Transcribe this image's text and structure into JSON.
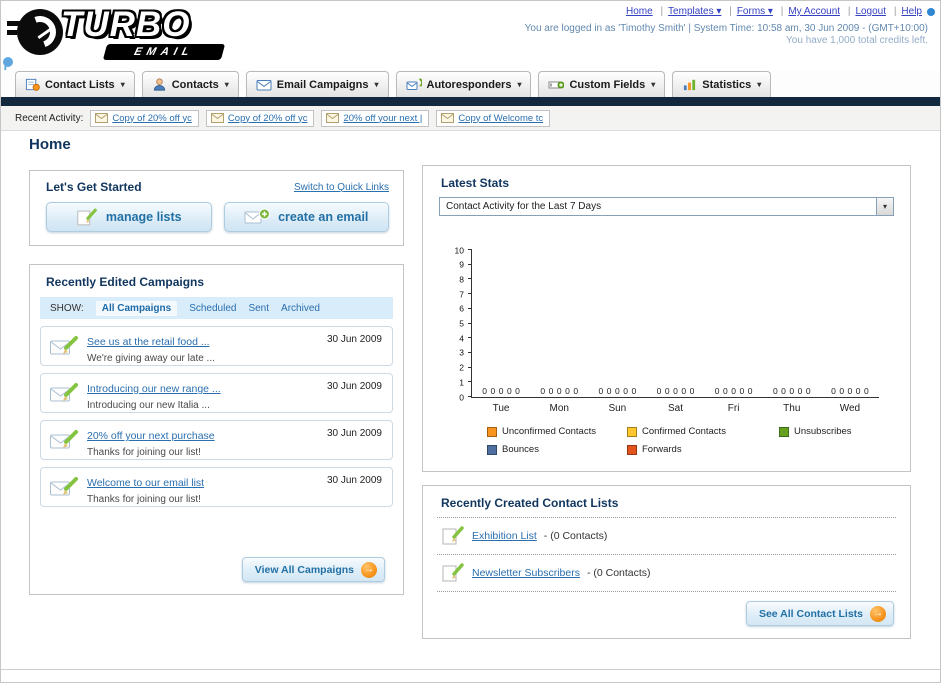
{
  "header": {
    "logo_title": "TURBO",
    "logo_subtitle": "EMAIL",
    "nav_links": [
      "Home",
      "Templates ▾",
      "Forms ▾",
      "My Account",
      "Logout",
      "Help"
    ],
    "login_info": "You are logged in as 'Timothy Smith' | System Time: 10:58 am, 30 Jun 2009 - (GMT+10:00)",
    "credits_info": "You have 1,000 total credits left."
  },
  "nav_tabs": [
    {
      "label": "Contact Lists"
    },
    {
      "label": "Contacts"
    },
    {
      "label": "Email Campaigns"
    },
    {
      "label": "Autoresponders"
    },
    {
      "label": "Custom Fields"
    },
    {
      "label": "Statistics"
    }
  ],
  "recent_activity": {
    "label": "Recent Activity:",
    "items": [
      "Copy of 20% off yc",
      "Copy of 20% off yc",
      "20% off your next |",
      "Copy of Welcome tc"
    ]
  },
  "page_title": "Home",
  "get_started": {
    "title": "Let's Get Started",
    "switch_link": "Switch to Quick Links",
    "manage_lists_label": "manage lists",
    "create_email_label": "create an email"
  },
  "campaigns": {
    "title": "Recently Edited Campaigns",
    "show_label": "SHOW:",
    "filters": [
      "All Campaigns",
      "Scheduled",
      "Sent",
      "Archived"
    ],
    "active_filter": "All Campaigns",
    "items": [
      {
        "title": "See us at the retail food ...",
        "subtitle": "We're giving away our late ...",
        "date": "30 Jun 2009"
      },
      {
        "title": "Introducing our new range ...",
        "subtitle": "Introducing our new Italia ...",
        "date": "30 Jun 2009"
      },
      {
        "title": "20% off your next purchase",
        "subtitle": "Thanks for joining our list!",
        "date": "30 Jun 2009"
      },
      {
        "title": "Welcome to our email list",
        "subtitle": "Thanks for joining our list!",
        "date": "30 Jun 2009"
      }
    ],
    "view_all_label": "View All Campaigns"
  },
  "stats": {
    "title": "Latest Stats",
    "period_value": "Contact Activity for the Last 7 Days",
    "chart_data": {
      "type": "bar",
      "categories": [
        "Tue",
        "Mon",
        "Sun",
        "Sat",
        "Fri",
        "Thu",
        "Wed"
      ],
      "series": [
        {
          "name": "Unconfirmed Contacts",
          "color": "#f7941d",
          "values": [
            0,
            0,
            0,
            0,
            0,
            0,
            0
          ]
        },
        {
          "name": "Confirmed Contacts",
          "color": "#fdc62e",
          "values": [
            0,
            0,
            0,
            0,
            0,
            0,
            0
          ]
        },
        {
          "name": "Unsubscribes",
          "color": "#64a21e",
          "values": [
            0,
            0,
            0,
            0,
            0,
            0,
            0
          ]
        },
        {
          "name": "Bounces",
          "color": "#4f6fa0",
          "values": [
            0,
            0,
            0,
            0,
            0,
            0,
            0
          ]
        },
        {
          "name": "Forwards",
          "color": "#e2531d",
          "values": [
            0,
            0,
            0,
            0,
            0,
            0,
            0
          ]
        }
      ],
      "ylim": [
        0,
        10
      ],
      "grid": false,
      "legend_position": "bottom"
    }
  },
  "contact_lists": {
    "title": "Recently Created Contact Lists",
    "items": [
      {
        "name": "Exhibition List",
        "detail": "- (0 Contacts)"
      },
      {
        "name": "Newsletter Subscribers",
        "detail": "- (0 Contacts)"
      }
    ],
    "see_all_label": "See All Contact Lists"
  },
  "icons": {
    "dropdown_arrow": "▾",
    "arrow_right": "→"
  }
}
